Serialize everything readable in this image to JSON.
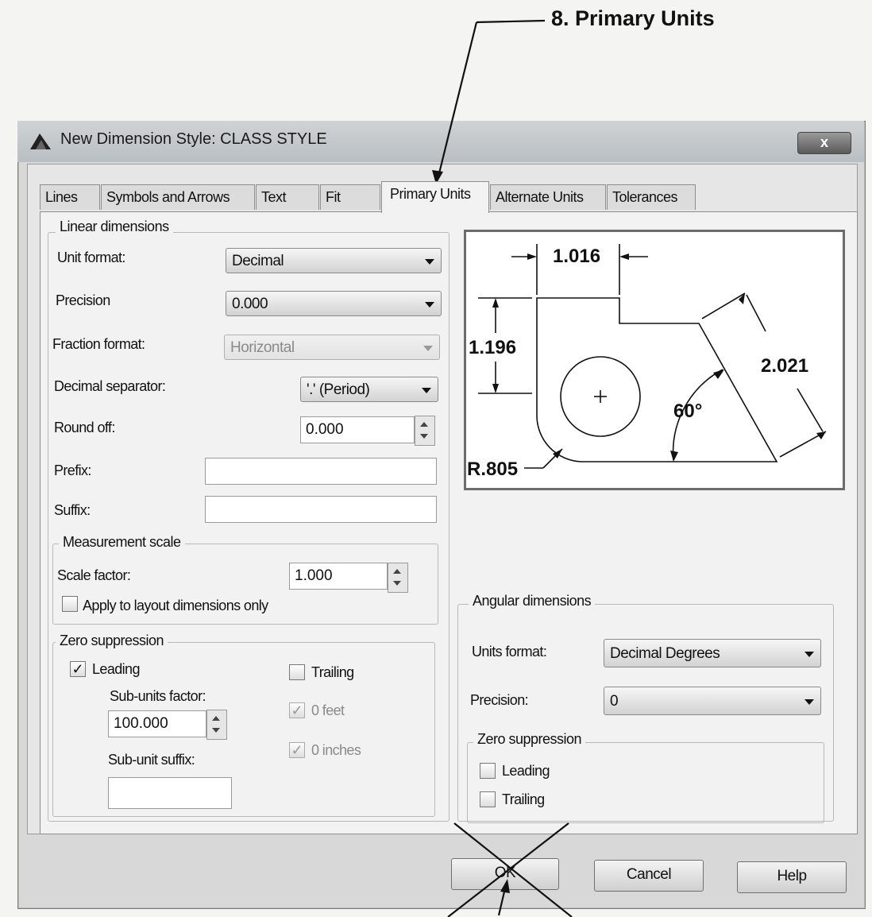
{
  "callout": {
    "label": "8.  Primary Units",
    "arrow_label": ""
  },
  "dialog": {
    "title": "New Dimension Style: CLASS STYLE",
    "close_label": "x"
  },
  "tabs": [
    {
      "label": "Lines",
      "active": false
    },
    {
      "label": "Symbols and Arrows",
      "active": false
    },
    {
      "label": "Text",
      "active": false
    },
    {
      "label": "Fit",
      "active": false
    },
    {
      "label": "Primary Units",
      "active": true
    },
    {
      "label": "Alternate Units",
      "active": false
    },
    {
      "label": "Tolerances",
      "active": false
    }
  ],
  "linear": {
    "title": "Linear dimensions",
    "unit_format_label": "Unit format:",
    "unit_format_value": "Decimal",
    "precision_label": "Precision",
    "precision_value": "0.000",
    "fraction_format_label": "Fraction format:",
    "fraction_format_value": "Horizontal",
    "decimal_separator_label": "Decimal separator:",
    "decimal_separator_value": "'.' (Period)",
    "round_off_label": "Round off:",
    "round_off_value": "0.000",
    "prefix_label": "Prefix:",
    "prefix_value": "",
    "suffix_label": "Suffix:",
    "suffix_value": ""
  },
  "measurement": {
    "title": "Measurement scale",
    "scale_factor_label": "Scale factor:",
    "scale_factor_value": "1.000",
    "apply_layout_label": "Apply to layout dimensions only",
    "apply_layout_checked": false
  },
  "zero_suppression": {
    "title": "Zero suppression",
    "leading_label": "Leading",
    "leading_checked": true,
    "trailing_label": "Trailing",
    "trailing_checked": false,
    "sub_units_factor_label": "Sub-units factor:",
    "sub_units_factor_value": "100.000",
    "sub_unit_suffix_label": "Sub-unit suffix:",
    "sub_unit_suffix_value": "",
    "zero_feet_label": "0 feet",
    "zero_feet_checked": true,
    "zero_inches_label": "0 inches",
    "zero_inches_checked": true
  },
  "preview": {
    "dim_top": "1.016",
    "dim_left": "1.196",
    "dim_right": "2.021",
    "angle": "60°",
    "radius": "R.805"
  },
  "angular": {
    "title": "Angular dimensions",
    "units_format_label": "Units format:",
    "units_format_value": "Decimal Degrees",
    "precision_label": "Precision:",
    "precision_value": "0",
    "zero_title": "Zero suppression",
    "leading_label": "Leading",
    "leading_checked": false,
    "trailing_label": "Trailing",
    "trailing_checked": false
  },
  "buttons": {
    "ok": "OK",
    "cancel": "Cancel",
    "help": "Help"
  },
  "colors": {
    "dialog_bg": "#d8d8d8",
    "page_bg": "#f2f2f2",
    "close_button": "#5a5a5a"
  }
}
